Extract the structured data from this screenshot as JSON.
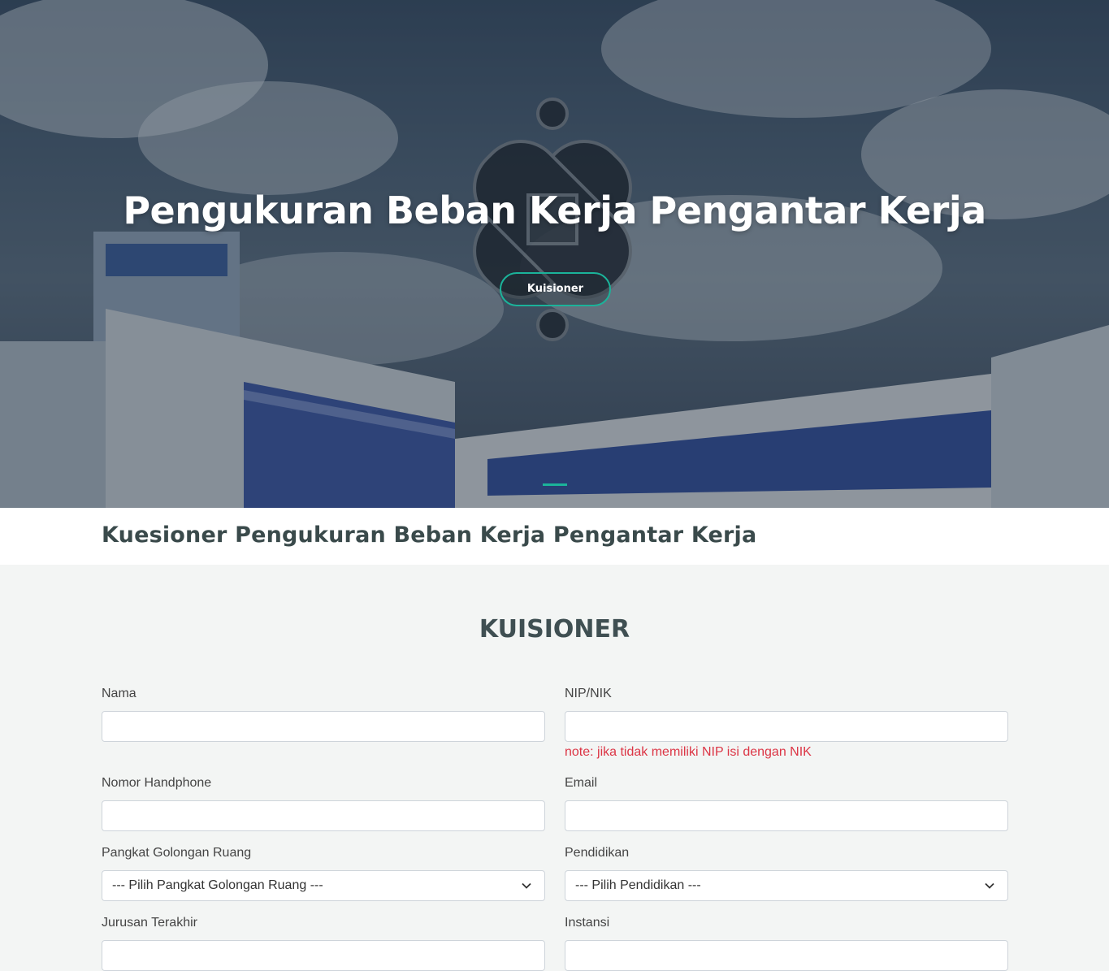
{
  "hero": {
    "title": "Pengukuran Beban Kerja Pengantar Kerja",
    "button_label": "Kuisioner",
    "accent_color": "#1bb39a"
  },
  "breadcrumb": {
    "title": "Kuesioner Pengukuran Beban Kerja Pengantar Kerja"
  },
  "form": {
    "section_title": "KUISIONER",
    "fields": {
      "nama": {
        "label": "Nama",
        "value": ""
      },
      "nip": {
        "label": "NIP/NIK",
        "value": "",
        "note": "note: jika tidak memiliki NIP isi dengan NIK"
      },
      "hp": {
        "label": "Nomor Handphone",
        "value": ""
      },
      "email": {
        "label": "Email",
        "value": ""
      },
      "pangkat": {
        "label": "Pangkat Golongan Ruang",
        "selected": "--- Pilih Pangkat Golongan Ruang ---",
        "icon": "chevron-down-icon"
      },
      "pendidikan": {
        "label": "Pendidikan",
        "selected": "--- Pilih Pendidikan ---",
        "icon": "chevron-down-icon"
      },
      "jurusan": {
        "label": "Jurusan Terakhir",
        "value": ""
      },
      "instansi": {
        "label": "Instansi",
        "value": ""
      }
    }
  }
}
